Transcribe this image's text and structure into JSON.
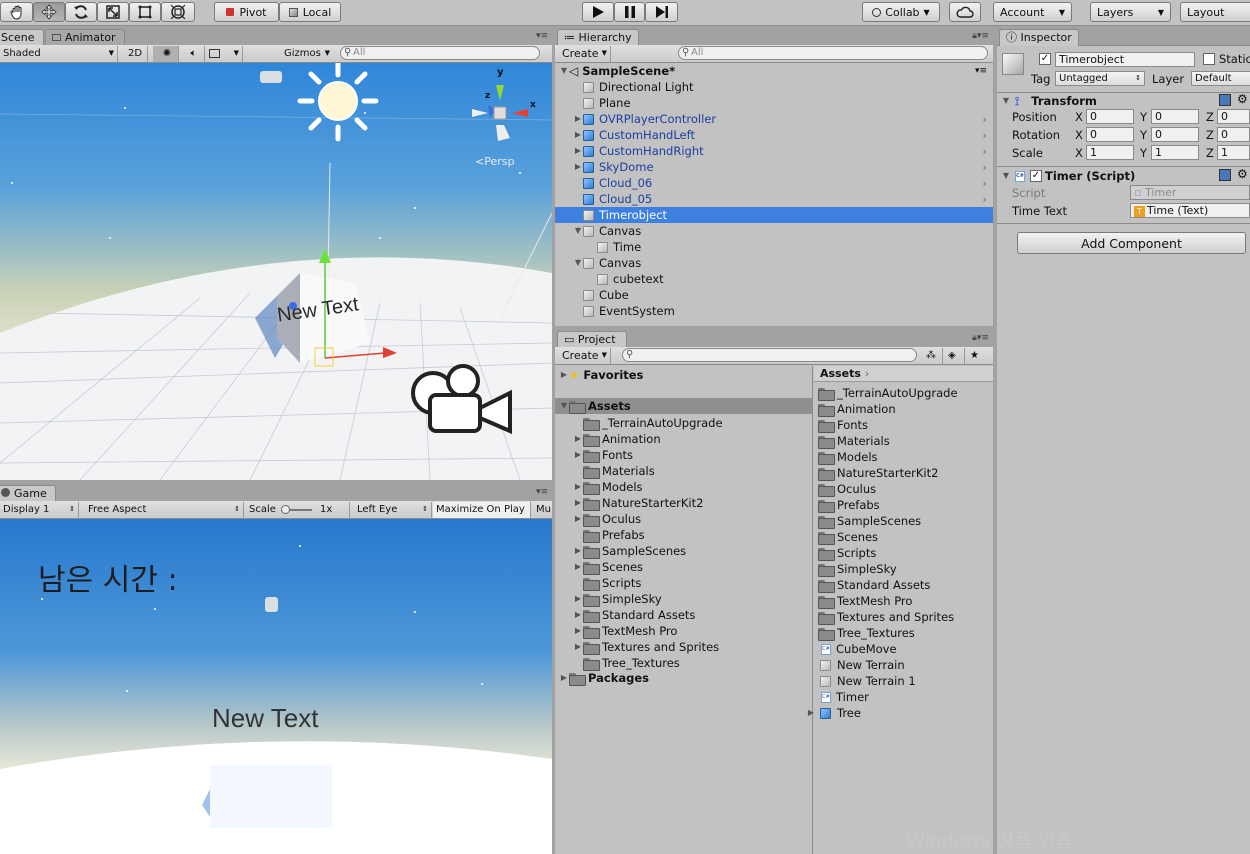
{
  "toolbar": {
    "pivot": "Pivot",
    "local": "Local",
    "collab": "Collab",
    "account": "Account",
    "layers": "Layers",
    "layout": "Layout"
  },
  "scene": {
    "tab_scene": "Scene",
    "tab_animator": "Animator",
    "shading": "Shaded",
    "mode2d": "2D",
    "gizmos": "Gizmos",
    "search_placeholder": "All",
    "persp": "Persp",
    "world_text": "New Text",
    "axis_x": "x",
    "axis_y": "y",
    "axis_z": "z"
  },
  "game": {
    "tab": "Game",
    "display": "Display 1",
    "aspect": "Free Aspect",
    "scale_label": "Scale",
    "scale_value": "1x",
    "eye": "Left Eye",
    "maximize": "Maximize On Play",
    "mute": "Mu",
    "korean_text": "남은 시간 :",
    "new_text": "New Text"
  },
  "hierarchy": {
    "tab": "Hierarchy",
    "create": "Create",
    "search_placeholder": "All",
    "scene_name": "SampleScene*",
    "items": [
      {
        "label": "Directional Light",
        "indent": 1,
        "arrow": "",
        "icon": "g",
        "blue": false,
        "selected": false,
        "prefab": false
      },
      {
        "label": "Plane",
        "indent": 1,
        "arrow": "",
        "icon": "g",
        "blue": false,
        "selected": false,
        "prefab": false
      },
      {
        "label": "OVRPlayerController",
        "indent": 1,
        "arrow": "▶",
        "icon": "b",
        "blue": true,
        "selected": false,
        "prefab": true
      },
      {
        "label": "CustomHandLeft",
        "indent": 1,
        "arrow": "▶",
        "icon": "b",
        "blue": true,
        "selected": false,
        "prefab": true
      },
      {
        "label": "CustomHandRight",
        "indent": 1,
        "arrow": "▶",
        "icon": "b",
        "blue": true,
        "selected": false,
        "prefab": true
      },
      {
        "label": "SkyDome",
        "indent": 1,
        "arrow": "▶",
        "icon": "b",
        "blue": true,
        "selected": false,
        "prefab": true
      },
      {
        "label": "Cloud_06",
        "indent": 1,
        "arrow": "",
        "icon": "b",
        "blue": true,
        "selected": false,
        "prefab": true
      },
      {
        "label": "Cloud_05",
        "indent": 1,
        "arrow": "",
        "icon": "b",
        "blue": true,
        "selected": false,
        "prefab": true
      },
      {
        "label": "Timerobject",
        "indent": 1,
        "arrow": "",
        "icon": "g",
        "blue": false,
        "selected": true,
        "prefab": false
      },
      {
        "label": "Canvas",
        "indent": 1,
        "arrow": "▼",
        "icon": "g",
        "blue": false,
        "selected": false,
        "prefab": false
      },
      {
        "label": "Time",
        "indent": 2,
        "arrow": "",
        "icon": "g",
        "blue": false,
        "selected": false,
        "prefab": false
      },
      {
        "label": "Canvas",
        "indent": 1,
        "arrow": "▼",
        "icon": "g",
        "blue": false,
        "selected": false,
        "prefab": false
      },
      {
        "label": "cubetext",
        "indent": 2,
        "arrow": "",
        "icon": "g",
        "blue": false,
        "selected": false,
        "prefab": false
      },
      {
        "label": "Cube",
        "indent": 1,
        "arrow": "",
        "icon": "g",
        "blue": false,
        "selected": false,
        "prefab": false
      },
      {
        "label": "EventSystem",
        "indent": 1,
        "arrow": "",
        "icon": "g",
        "blue": false,
        "selected": false,
        "prefab": false
      }
    ]
  },
  "project": {
    "tab": "Project",
    "create": "Create",
    "favorites": "Favorites",
    "assets": "Assets",
    "packages": "Packages",
    "breadcrumb": "Assets",
    "tree": [
      "_TerrainAutoUpgrade",
      "Animation",
      "Fonts",
      "Materials",
      "Models",
      "NatureStarterKit2",
      "Oculus",
      "Prefabs",
      "SampleScenes",
      "Scenes",
      "Scripts",
      "SimpleSky",
      "Standard Assets",
      "TextMesh Pro",
      "Textures and Sprites",
      "Tree_Textures"
    ],
    "tree_arrows": [
      false,
      true,
      true,
      false,
      true,
      true,
      true,
      false,
      true,
      true,
      false,
      true,
      true,
      true,
      true,
      false
    ],
    "contents": [
      {
        "label": "_TerrainAutoUpgrade",
        "icon": "folder"
      },
      {
        "label": "Animation",
        "icon": "folder"
      },
      {
        "label": "Fonts",
        "icon": "folder"
      },
      {
        "label": "Materials",
        "icon": "folder"
      },
      {
        "label": "Models",
        "icon": "folder"
      },
      {
        "label": "NatureStarterKit2",
        "icon": "folder"
      },
      {
        "label": "Oculus",
        "icon": "folder"
      },
      {
        "label": "Prefabs",
        "icon": "folder"
      },
      {
        "label": "SampleScenes",
        "icon": "folder"
      },
      {
        "label": "Scenes",
        "icon": "folder"
      },
      {
        "label": "Scripts",
        "icon": "folder"
      },
      {
        "label": "SimpleSky",
        "icon": "folder"
      },
      {
        "label": "Standard Assets",
        "icon": "folder"
      },
      {
        "label": "TextMesh Pro",
        "icon": "folder"
      },
      {
        "label": "Textures and Sprites",
        "icon": "folder"
      },
      {
        "label": "Tree_Textures",
        "icon": "folder"
      },
      {
        "label": "CubeMove",
        "icon": "script"
      },
      {
        "label": "New Terrain",
        "icon": "terrain"
      },
      {
        "label": "New Terrain 1",
        "icon": "terrain"
      },
      {
        "label": "Timer",
        "icon": "script"
      },
      {
        "label": "Tree",
        "icon": "prefab"
      }
    ]
  },
  "inspector": {
    "tab": "Inspector",
    "object_name": "Timerobject",
    "static": "Static",
    "tag_label": "Tag",
    "tag_value": "Untagged",
    "layer_label": "Layer",
    "layer_value": "Default",
    "transform": {
      "title": "Transform",
      "rows": [
        {
          "label": "Position",
          "x": "0",
          "y": "0",
          "z": "0"
        },
        {
          "label": "Rotation",
          "x": "0",
          "y": "0",
          "z": "0"
        },
        {
          "label": "Scale",
          "x": "1",
          "y": "1",
          "z": "1"
        }
      ]
    },
    "script_component": {
      "title": "Timer (Script)",
      "script_label": "Script",
      "script_value": "Timer",
      "timetext_label": "Time Text",
      "timetext_value": "Time (Text)"
    },
    "add_component": "Add Component"
  },
  "watermark": "Windows 정품 인증"
}
